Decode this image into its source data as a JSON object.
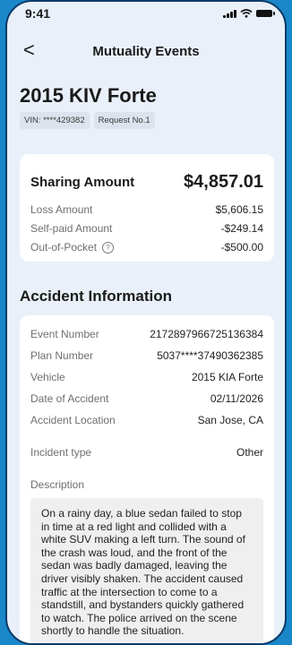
{
  "status_bar": {
    "time": "9:41",
    "icons": [
      "signal-icon",
      "wifi-icon",
      "battery-icon"
    ]
  },
  "nav": {
    "back_glyph": "<",
    "title": "Mutuality Events"
  },
  "vehicle": {
    "title": "2015 KIV Forte",
    "tags": [
      "VIN: ****429382",
      "Request No.1"
    ]
  },
  "sharing": {
    "label": "Sharing Amount",
    "amount": "$4,857.01",
    "rows": [
      {
        "label": "Loss Amount",
        "value": "$5,606.15"
      },
      {
        "label": "Self-paid Amount",
        "value": "-$249.14"
      },
      {
        "label": "Out-of-Pocket",
        "value": "-$500.00",
        "help_glyph": "?"
      }
    ]
  },
  "accident": {
    "section_title": "Accident Information",
    "fields": [
      {
        "label": "Event Number",
        "value": "2172897966725136384"
      },
      {
        "label": "Plan Number",
        "value": "5037****37490362385"
      },
      {
        "label": "Vehicle",
        "value": "2015 KIA Forte"
      },
      {
        "label": "Date of Accident",
        "value": "02/11/2026"
      },
      {
        "label": "Accident Location",
        "value": "San Jose, CA"
      }
    ],
    "incident_type": {
      "label": "Incident type",
      "value": "Other"
    },
    "description_label": "Description",
    "description": "On a rainy day, a blue sedan failed to stop in time at a red light and collided with a white SUV making a left turn. The sound of the crash was loud, and the front of the sedan was badly damaged, leaving the driver visibly shaken. The accident caused traffic at the intersection to come to a standstill, and bystanders quickly gathered to watch. The police arrived on the scene shortly to handle the situation."
  },
  "colors": {
    "background": "#1a87c9",
    "screen": "#e9f0fa",
    "frame": "#0c3a68"
  }
}
